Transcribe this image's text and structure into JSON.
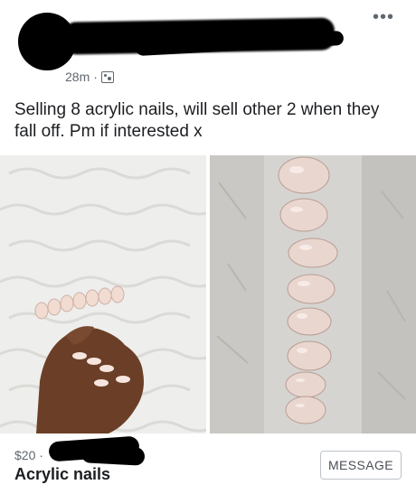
{
  "post": {
    "time": "28m",
    "separator": "·",
    "text": "Selling 8 acrylic nails, will sell other 2 when they fall off. Pm if interested x",
    "audience_icon": "audience-icon",
    "more_icon": "more-options-icon"
  },
  "listing": {
    "price": "$20 ·",
    "title": "Acrylic nails",
    "message_label": "MESSAGE"
  },
  "photos": [
    {
      "name": "nails-on-hand-photo",
      "icon": "photo"
    },
    {
      "name": "nails-in-row-photo",
      "icon": "photo"
    }
  ]
}
